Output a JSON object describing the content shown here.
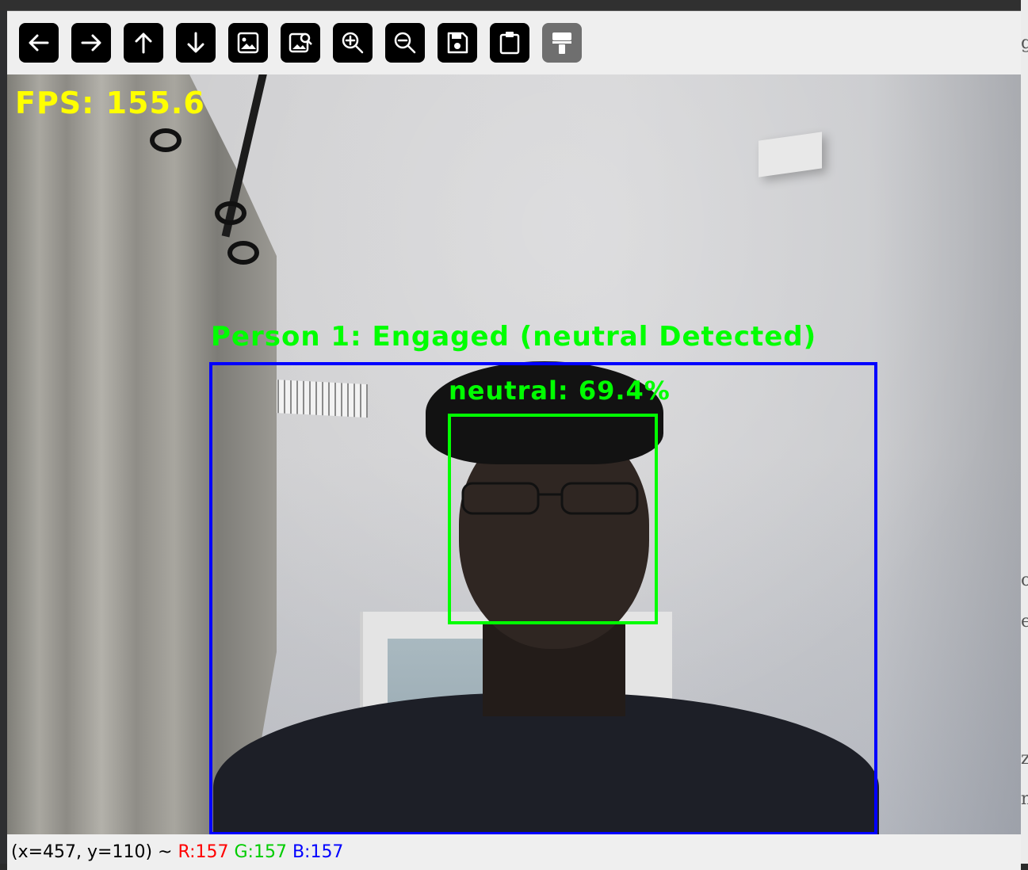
{
  "toolbar": {
    "buttons": [
      {
        "name": "pan-left-button",
        "icon": "arrow-left-icon"
      },
      {
        "name": "pan-right-button",
        "icon": "arrow-right-icon"
      },
      {
        "name": "pan-up-button",
        "icon": "arrow-up-icon"
      },
      {
        "name": "pan-down-button",
        "icon": "arrow-down-icon"
      },
      {
        "name": "zoom-fit-button",
        "icon": "image-icon"
      },
      {
        "name": "zoom-original-button",
        "icon": "image-search-icon"
      },
      {
        "name": "zoom-in-button",
        "icon": "zoom-in-icon"
      },
      {
        "name": "zoom-out-button",
        "icon": "zoom-out-icon"
      },
      {
        "name": "save-image-button",
        "icon": "save-icon"
      },
      {
        "name": "copy-to-clipboard-button",
        "icon": "clipboard-icon"
      },
      {
        "name": "properties-button",
        "icon": "paint-brush-icon",
        "disabled": true
      }
    ]
  },
  "overlay": {
    "fps_text": "FPS: 155.6",
    "fps_color": "#ffff00",
    "person_label": "Person 1: Engaged (neutral Detected)",
    "emotion_label": "neutral: 69.4%",
    "label_color": "#00ff00",
    "person_box_color": "#0000ff",
    "face_box_color": "#00ff00"
  },
  "status": {
    "coords": "(x=457, y=110) ~ ",
    "r": "R:157",
    "g": "G:157",
    "b": "B:157"
  }
}
